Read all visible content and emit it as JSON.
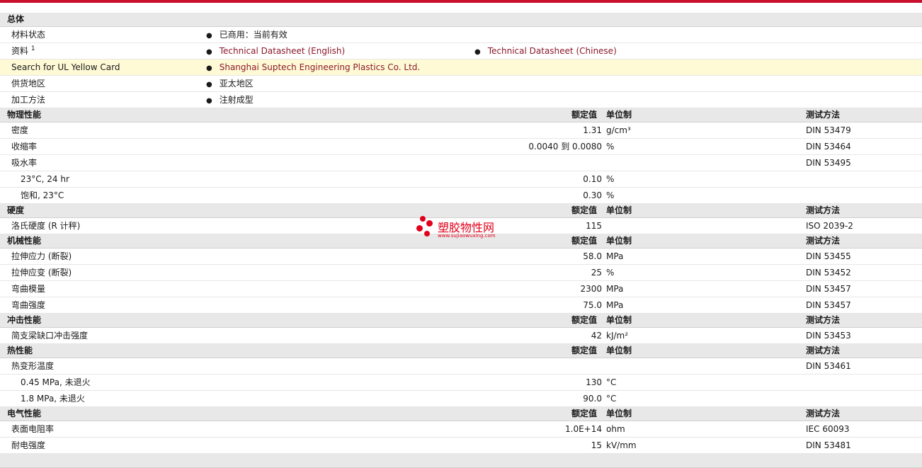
{
  "general": {
    "title": "总体",
    "rows": [
      {
        "label": "材料状态",
        "items": [
          "已商用：当前有效"
        ]
      },
      {
        "label": "资料",
        "sup": "1",
        "items": [
          "Technical Datasheet (English)",
          "Technical Datasheet (Chinese)"
        ]
      },
      {
        "label": "Search for UL Yellow Card",
        "items": [
          "Shanghai Suptech Engineering Plastics Co. Ltd."
        ]
      },
      {
        "label": "供货地区",
        "items": [
          "亚太地区"
        ]
      },
      {
        "label": "加工方法",
        "items": [
          "注射成型"
        ]
      }
    ]
  },
  "column_headers": {
    "nominal": "额定值",
    "unit": "单位制",
    "method": "测试方法"
  },
  "sections": [
    {
      "title": "物理性能",
      "rows": [
        {
          "label": "密度",
          "value": "1.31",
          "unit": "g/cm³",
          "method": "DIN 53479"
        },
        {
          "label": "收缩率",
          "value": "0.0040 到  0.0080",
          "unit": "%",
          "method": "DIN 53464"
        },
        {
          "label": "吸水率",
          "value": "",
          "unit": "",
          "method": "DIN 53495"
        },
        {
          "label": "23°C, 24 hr",
          "value": "0.10",
          "unit": "%",
          "method": ""
        },
        {
          "label": "饱和, 23°C",
          "value": "0.30",
          "unit": "%",
          "method": ""
        }
      ]
    },
    {
      "title": "硬度",
      "rows": [
        {
          "label": "洛氏硬度 (R 计秤)",
          "value": "115",
          "unit": "",
          "method": "ISO 2039-2"
        }
      ]
    },
    {
      "title": "机械性能",
      "rows": [
        {
          "label": "拉伸应力 (断裂)",
          "value": "58.0",
          "unit": "MPa",
          "method": "DIN 53455"
        },
        {
          "label": "拉伸应变 (断裂)",
          "value": "25",
          "unit": "%",
          "method": "DIN 53452"
        },
        {
          "label": "弯曲模量",
          "value": "2300",
          "unit": "MPa",
          "method": "DIN 53457"
        },
        {
          "label": "弯曲强度",
          "value": "75.0",
          "unit": "MPa",
          "method": "DIN 53457"
        }
      ]
    },
    {
      "title": "冲击性能",
      "rows": [
        {
          "label": "简支梁缺口冲击强度",
          "value": "42",
          "unit": "kJ/m²",
          "method": "DIN 53453"
        }
      ]
    },
    {
      "title": "热性能",
      "rows": [
        {
          "label": "热变形温度",
          "value": "",
          "unit": "",
          "method": "DIN 53461"
        },
        {
          "label": "0.45 MPa, 未退火",
          "value": "130",
          "unit": "°C",
          "method": ""
        },
        {
          "label": "1.8 MPa, 未退火",
          "value": "90.0",
          "unit": "°C",
          "method": ""
        }
      ]
    },
    {
      "title": "电气性能",
      "rows": [
        {
          "label": "表面电阻率",
          "value": "1.0E+14",
          "unit": "ohm",
          "method": "IEC 60093"
        },
        {
          "label": "耐电强度",
          "value": "15",
          "unit": "kV/mm",
          "method": "DIN 53481"
        }
      ]
    }
  ],
  "watermark": {
    "name": "塑胶物性网",
    "url": "www.sujiaowuxing.com"
  }
}
